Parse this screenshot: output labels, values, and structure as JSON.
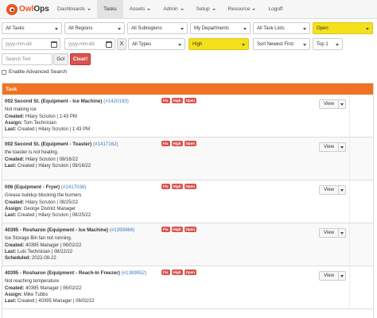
{
  "brand": {
    "name_a": "Owl",
    "name_b": "Ops"
  },
  "nav": [
    {
      "label": "Dashboards",
      "dropdown": true
    },
    {
      "label": "Tasks",
      "dropdown": false,
      "active": true
    },
    {
      "label": "Assets",
      "dropdown": true
    },
    {
      "label": "Admin",
      "dropdown": true
    },
    {
      "label": "Setup",
      "dropdown": true
    },
    {
      "label": "Resource",
      "dropdown": true
    },
    {
      "label": "Logoff",
      "dropdown": false
    }
  ],
  "filters": {
    "tasks": "All Tasks",
    "regions": "All Regions",
    "subregions": "All Subregions",
    "departments": "My Departments",
    "task_lists": "All Task Lists",
    "status": "Open",
    "date_from_placeholder": "yyyy-mm-dd",
    "date_to_placeholder": "yyyy-mm-dd",
    "clear_x": "X",
    "types": "All Types",
    "priority": "High",
    "sort": "Sort Newest First",
    "top": "Top 1",
    "search_placeholder": "Search Text",
    "go_label": "Go!",
    "clear_label": "Clear!",
    "advanced_label": "Enable Advanced Search"
  },
  "colors": {
    "accent": "#f07324",
    "highlight": "#f5e11b",
    "danger": "#d9534f",
    "link": "#3a7bbf"
  },
  "table": {
    "header": "Task",
    "view_label": "View",
    "rows": [
      {
        "title": "002 Second St. (Equipment - Ice Machine)",
        "ref": "(#1420193)",
        "badges": [
          "Fix",
          "High",
          "Open"
        ],
        "desc": "Not making ice",
        "lines": [
          {
            "label": "Created:",
            "value": "Hilary Scruton | 1:43 PM"
          },
          {
            "label": "Assign:",
            "value": "Tom Technician"
          },
          {
            "label": "Last:",
            "value": "Created | Hilary Scruton | 1:43 PM"
          }
        ]
      },
      {
        "title": "002 Second St. (Equipment - Toaster)",
        "ref": "(#1417162)",
        "badges": [
          "Fix",
          "High",
          "Open"
        ],
        "desc": "the toaster is not heating.",
        "lines": [
          {
            "label": "Created:",
            "value": "Hilary Scruton | 09/16/22"
          },
          {
            "label": "Last:",
            "value": "Created | Hilary Scruton | 09/16/22"
          }
        ]
      },
      {
        "title": "006 (Equipment - Fryer)",
        "ref": "(#1417036)",
        "badges": [
          "Fix",
          "High",
          "Open"
        ],
        "desc": "Grease buildup blocking the burners",
        "lines": [
          {
            "label": "Created:",
            "value": "Hilary Scruton | 08/25/22"
          },
          {
            "label": "Assign:",
            "value": "George District Manager"
          },
          {
            "label": "Last:",
            "value": "Created | Hilary Scruton | 08/25/22"
          }
        ]
      },
      {
        "title": "40395 - Rosharon (Equipment - Ice Machine)",
        "ref": "(#1399966)",
        "badges": [
          "Fix",
          "High",
          "Open"
        ],
        "desc": "Ice Storage Bin fan not running.",
        "lines": [
          {
            "label": "Created:",
            "value": "40395 Manager | 06/02/22"
          },
          {
            "label": "Last:",
            "value": "Luis Technician | 08/22/22"
          },
          {
            "label": "Scheduled:",
            "value": "2022-08-22"
          }
        ]
      },
      {
        "title": "40395 - Rosharon (Equipment - Reach-In Freezer)",
        "ref": "(#1399952)",
        "badges": [
          "Fix",
          "High",
          "Open"
        ],
        "desc": "Not reaching temperature",
        "lines": [
          {
            "label": "Created:",
            "value": "40395 Manager | 06/02/22"
          },
          {
            "label": "Assign:",
            "value": "Mike Tubbs"
          },
          {
            "label": "Last:",
            "value": "Created | 40395 Manager | 06/02/22"
          }
        ]
      }
    ]
  }
}
